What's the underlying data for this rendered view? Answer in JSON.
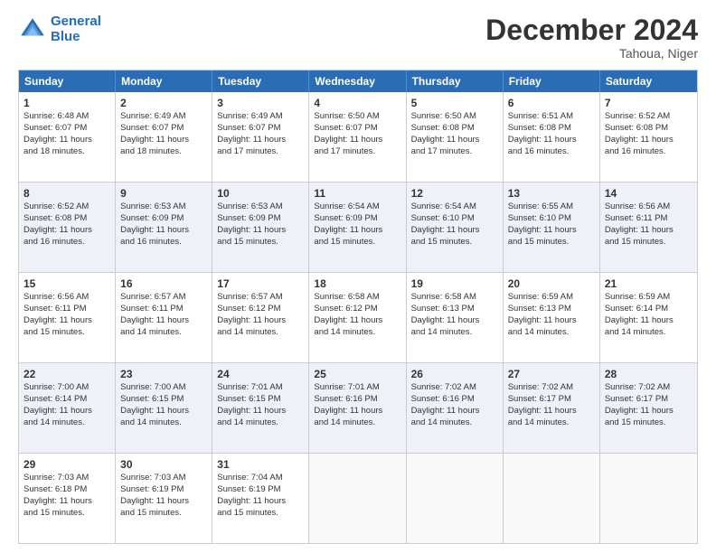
{
  "logo": {
    "line1": "General",
    "line2": "Blue"
  },
  "title": "December 2024",
  "location": "Tahoua, Niger",
  "days_of_week": [
    "Sunday",
    "Monday",
    "Tuesday",
    "Wednesday",
    "Thursday",
    "Friday",
    "Saturday"
  ],
  "rows": [
    [
      {
        "day": "1",
        "lines": [
          "Sunrise: 6:48 AM",
          "Sunset: 6:07 PM",
          "Daylight: 11 hours",
          "and 18 minutes."
        ]
      },
      {
        "day": "2",
        "lines": [
          "Sunrise: 6:49 AM",
          "Sunset: 6:07 PM",
          "Daylight: 11 hours",
          "and 18 minutes."
        ]
      },
      {
        "day": "3",
        "lines": [
          "Sunrise: 6:49 AM",
          "Sunset: 6:07 PM",
          "Daylight: 11 hours",
          "and 17 minutes."
        ]
      },
      {
        "day": "4",
        "lines": [
          "Sunrise: 6:50 AM",
          "Sunset: 6:07 PM",
          "Daylight: 11 hours",
          "and 17 minutes."
        ]
      },
      {
        "day": "5",
        "lines": [
          "Sunrise: 6:50 AM",
          "Sunset: 6:08 PM",
          "Daylight: 11 hours",
          "and 17 minutes."
        ]
      },
      {
        "day": "6",
        "lines": [
          "Sunrise: 6:51 AM",
          "Sunset: 6:08 PM",
          "Daylight: 11 hours",
          "and 16 minutes."
        ]
      },
      {
        "day": "7",
        "lines": [
          "Sunrise: 6:52 AM",
          "Sunset: 6:08 PM",
          "Daylight: 11 hours",
          "and 16 minutes."
        ]
      }
    ],
    [
      {
        "day": "8",
        "lines": [
          "Sunrise: 6:52 AM",
          "Sunset: 6:08 PM",
          "Daylight: 11 hours",
          "and 16 minutes."
        ]
      },
      {
        "day": "9",
        "lines": [
          "Sunrise: 6:53 AM",
          "Sunset: 6:09 PM",
          "Daylight: 11 hours",
          "and 16 minutes."
        ]
      },
      {
        "day": "10",
        "lines": [
          "Sunrise: 6:53 AM",
          "Sunset: 6:09 PM",
          "Daylight: 11 hours",
          "and 15 minutes."
        ]
      },
      {
        "day": "11",
        "lines": [
          "Sunrise: 6:54 AM",
          "Sunset: 6:09 PM",
          "Daylight: 11 hours",
          "and 15 minutes."
        ]
      },
      {
        "day": "12",
        "lines": [
          "Sunrise: 6:54 AM",
          "Sunset: 6:10 PM",
          "Daylight: 11 hours",
          "and 15 minutes."
        ]
      },
      {
        "day": "13",
        "lines": [
          "Sunrise: 6:55 AM",
          "Sunset: 6:10 PM",
          "Daylight: 11 hours",
          "and 15 minutes."
        ]
      },
      {
        "day": "14",
        "lines": [
          "Sunrise: 6:56 AM",
          "Sunset: 6:11 PM",
          "Daylight: 11 hours",
          "and 15 minutes."
        ]
      }
    ],
    [
      {
        "day": "15",
        "lines": [
          "Sunrise: 6:56 AM",
          "Sunset: 6:11 PM",
          "Daylight: 11 hours",
          "and 15 minutes."
        ]
      },
      {
        "day": "16",
        "lines": [
          "Sunrise: 6:57 AM",
          "Sunset: 6:11 PM",
          "Daylight: 11 hours",
          "and 14 minutes."
        ]
      },
      {
        "day": "17",
        "lines": [
          "Sunrise: 6:57 AM",
          "Sunset: 6:12 PM",
          "Daylight: 11 hours",
          "and 14 minutes."
        ]
      },
      {
        "day": "18",
        "lines": [
          "Sunrise: 6:58 AM",
          "Sunset: 6:12 PM",
          "Daylight: 11 hours",
          "and 14 minutes."
        ]
      },
      {
        "day": "19",
        "lines": [
          "Sunrise: 6:58 AM",
          "Sunset: 6:13 PM",
          "Daylight: 11 hours",
          "and 14 minutes."
        ]
      },
      {
        "day": "20",
        "lines": [
          "Sunrise: 6:59 AM",
          "Sunset: 6:13 PM",
          "Daylight: 11 hours",
          "and 14 minutes."
        ]
      },
      {
        "day": "21",
        "lines": [
          "Sunrise: 6:59 AM",
          "Sunset: 6:14 PM",
          "Daylight: 11 hours",
          "and 14 minutes."
        ]
      }
    ],
    [
      {
        "day": "22",
        "lines": [
          "Sunrise: 7:00 AM",
          "Sunset: 6:14 PM",
          "Daylight: 11 hours",
          "and 14 minutes."
        ]
      },
      {
        "day": "23",
        "lines": [
          "Sunrise: 7:00 AM",
          "Sunset: 6:15 PM",
          "Daylight: 11 hours",
          "and 14 minutes."
        ]
      },
      {
        "day": "24",
        "lines": [
          "Sunrise: 7:01 AM",
          "Sunset: 6:15 PM",
          "Daylight: 11 hours",
          "and 14 minutes."
        ]
      },
      {
        "day": "25",
        "lines": [
          "Sunrise: 7:01 AM",
          "Sunset: 6:16 PM",
          "Daylight: 11 hours",
          "and 14 minutes."
        ]
      },
      {
        "day": "26",
        "lines": [
          "Sunrise: 7:02 AM",
          "Sunset: 6:16 PM",
          "Daylight: 11 hours",
          "and 14 minutes."
        ]
      },
      {
        "day": "27",
        "lines": [
          "Sunrise: 7:02 AM",
          "Sunset: 6:17 PM",
          "Daylight: 11 hours",
          "and 14 minutes."
        ]
      },
      {
        "day": "28",
        "lines": [
          "Sunrise: 7:02 AM",
          "Sunset: 6:17 PM",
          "Daylight: 11 hours",
          "and 15 minutes."
        ]
      }
    ],
    [
      {
        "day": "29",
        "lines": [
          "Sunrise: 7:03 AM",
          "Sunset: 6:18 PM",
          "Daylight: 11 hours",
          "and 15 minutes."
        ]
      },
      {
        "day": "30",
        "lines": [
          "Sunrise: 7:03 AM",
          "Sunset: 6:19 PM",
          "Daylight: 11 hours",
          "and 15 minutes."
        ]
      },
      {
        "day": "31",
        "lines": [
          "Sunrise: 7:04 AM",
          "Sunset: 6:19 PM",
          "Daylight: 11 hours",
          "and 15 minutes."
        ]
      },
      {
        "day": "",
        "lines": []
      },
      {
        "day": "",
        "lines": []
      },
      {
        "day": "",
        "lines": []
      },
      {
        "day": "",
        "lines": []
      }
    ]
  ]
}
